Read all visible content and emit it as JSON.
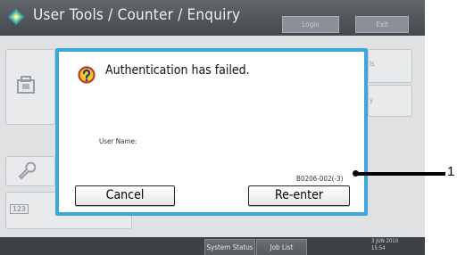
{
  "header": {
    "title": "User Tools / Counter / Enquiry",
    "login_label": "Login",
    "exit_label": "Exit"
  },
  "dialog": {
    "icon": "question-mark-icon",
    "message": "Authentication has failed.",
    "user_name_label": "User Name:",
    "error_code": "B0206-002(-3)",
    "cancel_label": "Cancel",
    "reenter_label": "Re-enter"
  },
  "footer": {
    "system_status_label": "System Status",
    "job_list_label": "Job List",
    "date": "3 JUN 2010",
    "time": "15:54"
  },
  "callout": {
    "number": "1"
  },
  "colors": {
    "dialog_border": "#3ea7d9",
    "titlebar": "#45484c"
  }
}
